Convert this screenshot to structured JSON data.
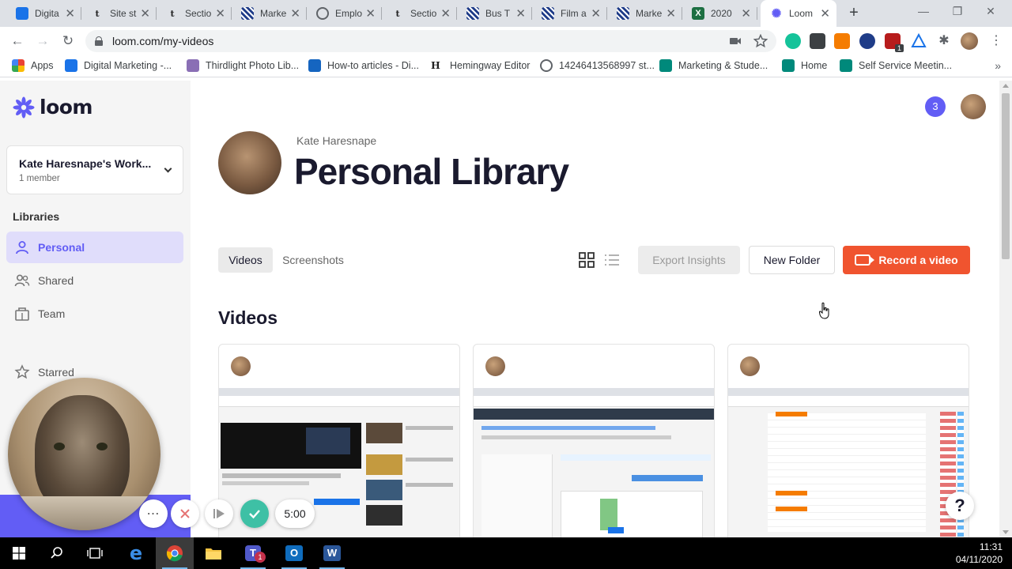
{
  "browser": {
    "tabs": [
      {
        "title": "Digita",
        "icon": "blue-bars-icon",
        "color": "#1a73e8"
      },
      {
        "title": "Site st",
        "icon": "t-logo-icon",
        "color": "#ffffff"
      },
      {
        "title": "Sectio",
        "icon": "t-logo-icon",
        "color": "#ffffff"
      },
      {
        "title": "Marke",
        "icon": "checkered-icon",
        "color": "#1f3c88"
      },
      {
        "title": "Emplo",
        "icon": "globe-icon",
        "color": "#5f6368"
      },
      {
        "title": "Sectio",
        "icon": "t-logo-icon",
        "color": "#ffffff"
      },
      {
        "title": "Bus T",
        "icon": "checkered-icon",
        "color": "#1f3c88"
      },
      {
        "title": "Film a",
        "icon": "checkered-icon",
        "color": "#1f3c88"
      },
      {
        "title": "Marke",
        "icon": "checkered-icon",
        "color": "#1f3c88"
      },
      {
        "title": "2020",
        "icon": "excel-icon",
        "color": "#1d6f42"
      },
      {
        "title": "Loom",
        "icon": "loom-icon",
        "color": "#625df5"
      }
    ],
    "url": "loom.com/my-videos",
    "bookmarks": [
      {
        "label": "Apps",
        "icon": "apps-grid-icon"
      },
      {
        "label": "Digital Marketing -...",
        "icon": "blue-bars-icon"
      },
      {
        "label": "Thirdlight Photo Lib...",
        "icon": "gear-icon"
      },
      {
        "label": "How-to articles - Di...",
        "icon": "x-logo-icon"
      },
      {
        "label": "Hemingway Editor",
        "icon": "h-logo-icon"
      },
      {
        "label": "14246413568997 st...",
        "icon": "globe-icon"
      },
      {
        "label": "Marketing & Stude...",
        "icon": "teal-logo-icon"
      },
      {
        "label": "Home",
        "icon": "teal-logo-icon"
      },
      {
        "label": "Self Service Meetin...",
        "icon": "teal-logo-icon"
      }
    ],
    "extension_badge": "1"
  },
  "sidebar": {
    "workspace_name": "Kate Haresnape's Work...",
    "workspace_members": "1 member",
    "section_label": "Libraries",
    "items": [
      {
        "label": "Personal",
        "icon": "person-icon",
        "active": true
      },
      {
        "label": "Shared",
        "icon": "people-icon",
        "active": false
      },
      {
        "label": "Team",
        "icon": "building-icon",
        "active": false
      },
      {
        "label": "Starred",
        "icon": "star-icon",
        "active": false
      }
    ]
  },
  "main": {
    "owner_name": "Kate Haresnape",
    "title": "Personal Library",
    "notification_count": "3",
    "tabs": [
      {
        "label": "Videos",
        "selected": true
      },
      {
        "label": "Screenshots",
        "selected": false
      }
    ],
    "buttons": {
      "export": "Export Insights",
      "new_folder": "New Folder",
      "record": "Record a video"
    },
    "section_heading": "Videos",
    "help_label": "?"
  },
  "recorder": {
    "timer": "5:00"
  },
  "taskbar": {
    "time": "11:31",
    "date": "04/11/2020",
    "teams_badge": "1"
  },
  "colors": {
    "brand": "#625df5",
    "record": "#f0542f"
  }
}
